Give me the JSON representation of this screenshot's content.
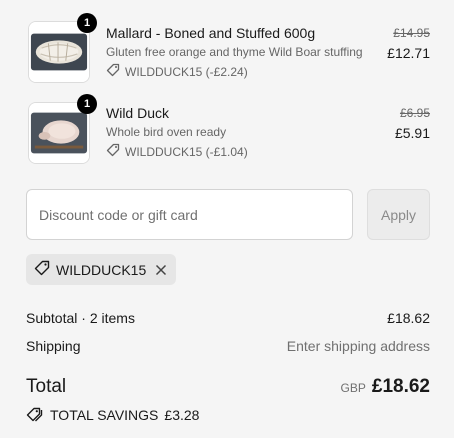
{
  "items": [
    {
      "quantity": "1",
      "name": "Mallard - Boned and Stuffed 600g",
      "description": "Gluten free orange and thyme Wild Boar stuffing",
      "discount": "WILDDUCK15 (-£2.24)",
      "original_price": "£14.95",
      "price": "£12.71",
      "image_icon": "stuffed-mallard-image"
    },
    {
      "quantity": "1",
      "name": "Wild Duck",
      "description": "Whole bird oven ready",
      "discount": "WILDDUCK15 (-£1.04)",
      "original_price": "£6.95",
      "price": "£5.91",
      "image_icon": "wild-duck-image"
    }
  ],
  "discount_form": {
    "placeholder": "Discount code or gift card",
    "apply_label": "Apply"
  },
  "applied_code": {
    "code": "WILDDUCK15"
  },
  "summary": {
    "subtotal_label": "Subtotal · 2 items",
    "subtotal_value": "£18.62",
    "shipping_label": "Shipping",
    "shipping_value": "Enter shipping address",
    "total_label": "Total",
    "currency": "GBP",
    "total_value": "£18.62",
    "savings_label": "TOTAL SAVINGS",
    "savings_value": "£3.28"
  },
  "colors": {
    "background": "#f5f5f5",
    "badge": "#000000",
    "muted_text": "#666666"
  }
}
